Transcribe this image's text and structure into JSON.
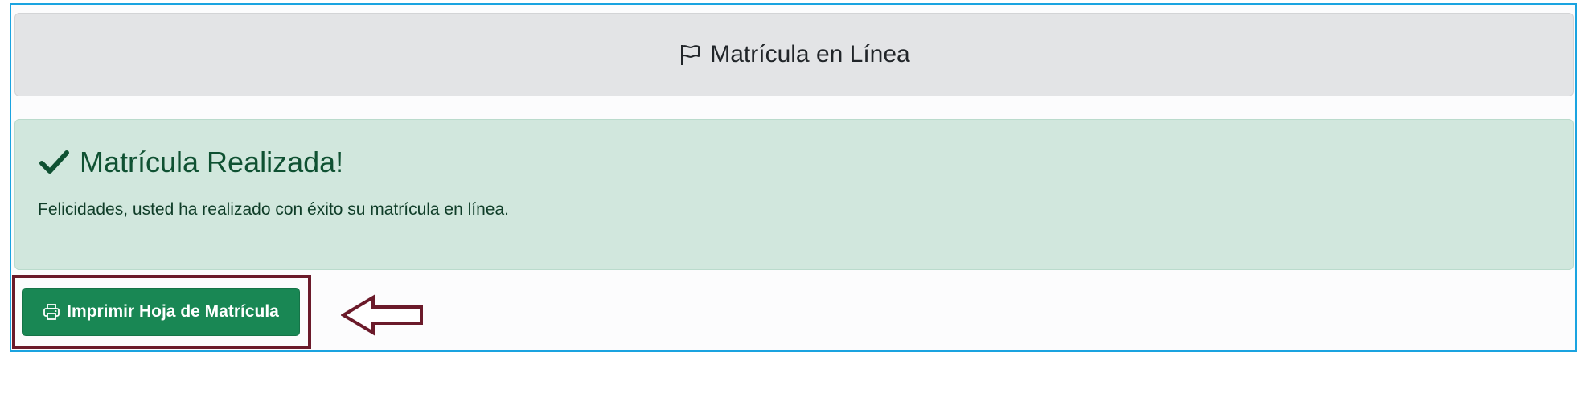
{
  "header": {
    "title": "Matrícula en Línea",
    "icon": "flag-icon"
  },
  "alert": {
    "heading": "Matrícula Realizada!",
    "message": "Felicidades, usted ha realizado con éxito su matrícula en línea.",
    "icon": "check-icon",
    "colors": {
      "background": "#d1e7dd",
      "text": "#0f5132"
    }
  },
  "actions": {
    "print_label": "Imprimir Hoja de Matrícula",
    "print_icon": "printer-icon",
    "button_color": "#198754"
  },
  "annotation": {
    "highlight_color": "#6b1a2a",
    "arrow_icon": "left-arrow-icon"
  }
}
